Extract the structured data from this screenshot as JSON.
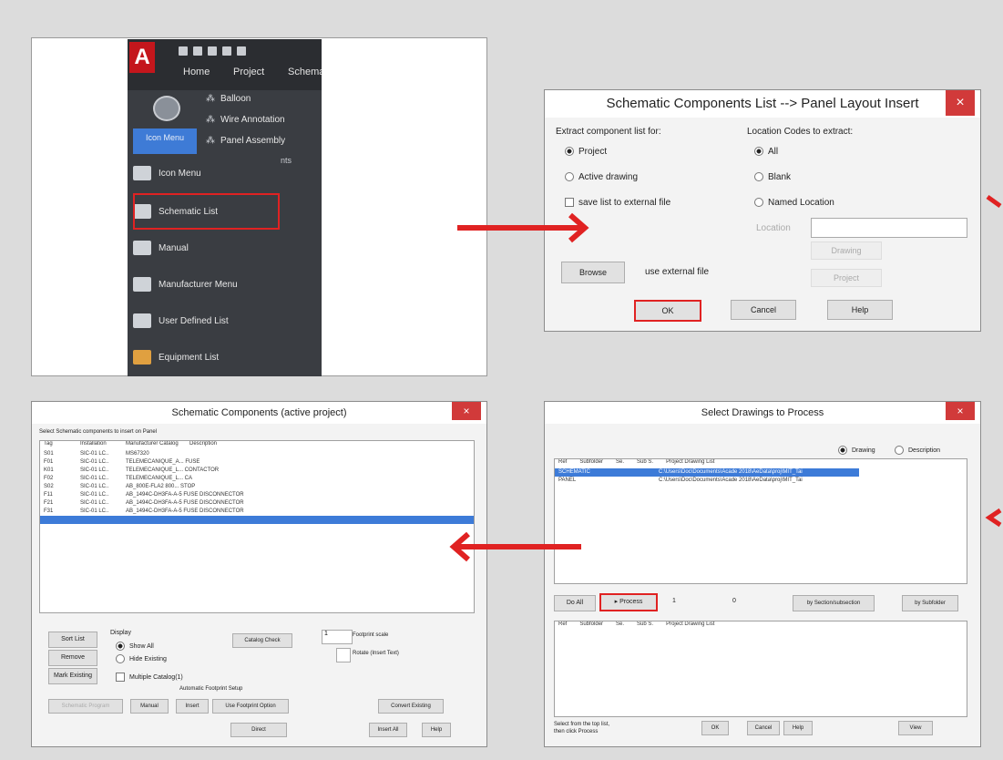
{
  "menu": {
    "tabs": [
      "Home",
      "Project",
      "Schema"
    ],
    "ribbon_items": [
      "Balloon",
      "Wire Annotation",
      "Panel Assembly"
    ],
    "split_label": "Icon Menu",
    "frag": "nts",
    "items": [
      "Icon Menu",
      "Schematic List",
      "Manual",
      "Manufacturer Menu",
      "User Defined List",
      "Equipment List"
    ]
  },
  "dialog1": {
    "title": "Schematic Components List --> Panel Layout Insert",
    "close": "×",
    "extract_label": "Extract component list for:",
    "options": [
      "Project",
      "Active drawing"
    ],
    "save_list": "save list to external file",
    "browse": "Browse",
    "use_external": "use external file",
    "location_label": "Location Codes to extract:",
    "loc_options": [
      "All",
      "Blank",
      "Named Location"
    ],
    "location_field": "Location",
    "drawing": "Drawing",
    "project": "Project",
    "ok": "OK",
    "cancel": "Cancel",
    "help": "Help"
  },
  "dialog2": {
    "title": "Select Drawings to Process",
    "close": "×",
    "radio_drawing": "Drawing",
    "radio_description": "Description",
    "columns": [
      "Ref",
      "Subfolder",
      "Se.",
      "Sub S.",
      "Project Drawing List"
    ],
    "rows": [
      {
        "ref": "SCHEMATIC",
        "path": "C:\\Users\\Doc\\Documents\\Acade 2018\\AeData\\proj\\MIT_Tai",
        "highlight": true
      },
      {
        "ref": "PANEL",
        "path": "C:\\Users\\Doc\\Documents\\Acade 2018\\AeData\\proj\\MIT_Tai",
        "highlight": false
      }
    ],
    "do_all": "Do All",
    "process": "Process",
    "range_a": "1",
    "range_b": "0",
    "by_section": "by Section/subsection",
    "by_subfolder": "by Subfolder",
    "bottom_text": "Select from the top list,\nthen click Process",
    "btn_ok": "OK",
    "btn_cancel": "Cancel",
    "btn_help": "Help",
    "btn_view": "View"
  },
  "dialog3": {
    "title": "Schematic Components (active project)",
    "close": "×",
    "subtitle": "Select Schematic components to insert on Panel",
    "columns": [
      "Tag",
      "Installation",
      "Manufacturer Catalog",
      "Description"
    ],
    "rows": [
      {
        "tag": "S01",
        "inst": "SIC-01 LC..",
        "cat": "MS67320",
        "hl": false
      },
      {
        "tag": "F01",
        "inst": "SIC-01 LC..",
        "cat": "TELEMECANIQUE_A... FUSE",
        "hl": false
      },
      {
        "tag": "K01",
        "inst": "SIC-01 LC..",
        "cat": "TELEMECANIQUE_L... CONTACTOR",
        "hl": false
      },
      {
        "tag": "F02",
        "inst": "SIC-01 LC..",
        "cat": "TELEMECANIQUE_L... CA",
        "hl": false
      },
      {
        "tag": "S02",
        "inst": "SIC-01 LC..",
        "cat": "AB_800E-FLA2 800... STOP",
        "hl": false
      },
      {
        "tag": "F11",
        "inst": "SIC-01 LC..",
        "cat": "AB_1494C-DH3FA-A-5 FUSE DISCONNECTOR",
        "hl": false
      },
      {
        "tag": "F21",
        "inst": "SIC-01 LC..",
        "cat": "AB_1494C-DH3FA-A-5 FUSE DISCONNECTOR",
        "hl": false
      },
      {
        "tag": "F31",
        "inst": "SIC-01 LC..",
        "cat": "AB_1494C-DH3FA-A-5 FUSE DISCONNECTOR",
        "hl": false
      },
      {
        "tag": "",
        "inst": "",
        "cat": "",
        "hl": true
      }
    ],
    "sort_list": "Sort List",
    "remove": "Remove",
    "mark_existing": "Mark Existing",
    "display": "Display",
    "show_all": "Show All",
    "hide_existing": "Hide Existing",
    "multiple_catalog": "Multiple Catalog(1)",
    "catalog_check": "Catalog Check",
    "footprint_scale": "Footprint scale",
    "rotate": "Rotate (Insert Text)",
    "scale_val": "1",
    "automatic_setup": "Automatic Footprint Setup",
    "schematic_program": "Schematic Program",
    "manual": "Manual",
    "insert": "Insert",
    "use_footprint": "Use Footprint Option",
    "convert_existing": "Convert Existing",
    "direct": "Direct",
    "insert_btn": "Insert All",
    "help": "Help"
  }
}
